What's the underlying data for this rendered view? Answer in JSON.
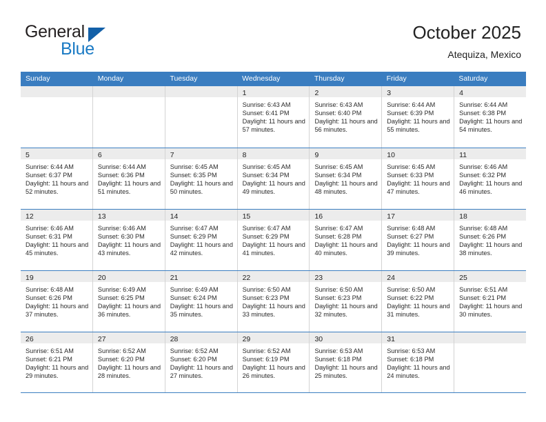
{
  "brand": {
    "name_part1": "General",
    "name_part2": "Blue",
    "triangle_color": "#1360a8",
    "blue_color": "#1a7ac4"
  },
  "header": {
    "title": "October 2025",
    "subtitle": "Atequiza, Mexico",
    "accent_color": "#3a7dc0",
    "band_color": "#ececec"
  },
  "calendar": {
    "day_headers": [
      "Sunday",
      "Monday",
      "Tuesday",
      "Wednesday",
      "Thursday",
      "Friday",
      "Saturday"
    ],
    "weeks": [
      [
        {
          "day": "",
          "empty": true
        },
        {
          "day": "",
          "empty": true
        },
        {
          "day": "",
          "empty": true
        },
        {
          "day": "1",
          "sunrise": "Sunrise: 6:43 AM",
          "sunset": "Sunset: 6:41 PM",
          "daylight": "Daylight: 11 hours and 57 minutes."
        },
        {
          "day": "2",
          "sunrise": "Sunrise: 6:43 AM",
          "sunset": "Sunset: 6:40 PM",
          "daylight": "Daylight: 11 hours and 56 minutes."
        },
        {
          "day": "3",
          "sunrise": "Sunrise: 6:44 AM",
          "sunset": "Sunset: 6:39 PM",
          "daylight": "Daylight: 11 hours and 55 minutes."
        },
        {
          "day": "4",
          "sunrise": "Sunrise: 6:44 AM",
          "sunset": "Sunset: 6:38 PM",
          "daylight": "Daylight: 11 hours and 54 minutes."
        }
      ],
      [
        {
          "day": "5",
          "sunrise": "Sunrise: 6:44 AM",
          "sunset": "Sunset: 6:37 PM",
          "daylight": "Daylight: 11 hours and 52 minutes."
        },
        {
          "day": "6",
          "sunrise": "Sunrise: 6:44 AM",
          "sunset": "Sunset: 6:36 PM",
          "daylight": "Daylight: 11 hours and 51 minutes."
        },
        {
          "day": "7",
          "sunrise": "Sunrise: 6:45 AM",
          "sunset": "Sunset: 6:35 PM",
          "daylight": "Daylight: 11 hours and 50 minutes."
        },
        {
          "day": "8",
          "sunrise": "Sunrise: 6:45 AM",
          "sunset": "Sunset: 6:34 PM",
          "daylight": "Daylight: 11 hours and 49 minutes."
        },
        {
          "day": "9",
          "sunrise": "Sunrise: 6:45 AM",
          "sunset": "Sunset: 6:34 PM",
          "daylight": "Daylight: 11 hours and 48 minutes."
        },
        {
          "day": "10",
          "sunrise": "Sunrise: 6:45 AM",
          "sunset": "Sunset: 6:33 PM",
          "daylight": "Daylight: 11 hours and 47 minutes."
        },
        {
          "day": "11",
          "sunrise": "Sunrise: 6:46 AM",
          "sunset": "Sunset: 6:32 PM",
          "daylight": "Daylight: 11 hours and 46 minutes."
        }
      ],
      [
        {
          "day": "12",
          "sunrise": "Sunrise: 6:46 AM",
          "sunset": "Sunset: 6:31 PM",
          "daylight": "Daylight: 11 hours and 45 minutes."
        },
        {
          "day": "13",
          "sunrise": "Sunrise: 6:46 AM",
          "sunset": "Sunset: 6:30 PM",
          "daylight": "Daylight: 11 hours and 43 minutes."
        },
        {
          "day": "14",
          "sunrise": "Sunrise: 6:47 AM",
          "sunset": "Sunset: 6:29 PM",
          "daylight": "Daylight: 11 hours and 42 minutes."
        },
        {
          "day": "15",
          "sunrise": "Sunrise: 6:47 AM",
          "sunset": "Sunset: 6:29 PM",
          "daylight": "Daylight: 11 hours and 41 minutes."
        },
        {
          "day": "16",
          "sunrise": "Sunrise: 6:47 AM",
          "sunset": "Sunset: 6:28 PM",
          "daylight": "Daylight: 11 hours and 40 minutes."
        },
        {
          "day": "17",
          "sunrise": "Sunrise: 6:48 AM",
          "sunset": "Sunset: 6:27 PM",
          "daylight": "Daylight: 11 hours and 39 minutes."
        },
        {
          "day": "18",
          "sunrise": "Sunrise: 6:48 AM",
          "sunset": "Sunset: 6:26 PM",
          "daylight": "Daylight: 11 hours and 38 minutes."
        }
      ],
      [
        {
          "day": "19",
          "sunrise": "Sunrise: 6:48 AM",
          "sunset": "Sunset: 6:26 PM",
          "daylight": "Daylight: 11 hours and 37 minutes."
        },
        {
          "day": "20",
          "sunrise": "Sunrise: 6:49 AM",
          "sunset": "Sunset: 6:25 PM",
          "daylight": "Daylight: 11 hours and 36 minutes."
        },
        {
          "day": "21",
          "sunrise": "Sunrise: 6:49 AM",
          "sunset": "Sunset: 6:24 PM",
          "daylight": "Daylight: 11 hours and 35 minutes."
        },
        {
          "day": "22",
          "sunrise": "Sunrise: 6:50 AM",
          "sunset": "Sunset: 6:23 PM",
          "daylight": "Daylight: 11 hours and 33 minutes."
        },
        {
          "day": "23",
          "sunrise": "Sunrise: 6:50 AM",
          "sunset": "Sunset: 6:23 PM",
          "daylight": "Daylight: 11 hours and 32 minutes."
        },
        {
          "day": "24",
          "sunrise": "Sunrise: 6:50 AM",
          "sunset": "Sunset: 6:22 PM",
          "daylight": "Daylight: 11 hours and 31 minutes."
        },
        {
          "day": "25",
          "sunrise": "Sunrise: 6:51 AM",
          "sunset": "Sunset: 6:21 PM",
          "daylight": "Daylight: 11 hours and 30 minutes."
        }
      ],
      [
        {
          "day": "26",
          "sunrise": "Sunrise: 6:51 AM",
          "sunset": "Sunset: 6:21 PM",
          "daylight": "Daylight: 11 hours and 29 minutes."
        },
        {
          "day": "27",
          "sunrise": "Sunrise: 6:52 AM",
          "sunset": "Sunset: 6:20 PM",
          "daylight": "Daylight: 11 hours and 28 minutes."
        },
        {
          "day": "28",
          "sunrise": "Sunrise: 6:52 AM",
          "sunset": "Sunset: 6:20 PM",
          "daylight": "Daylight: 11 hours and 27 minutes."
        },
        {
          "day": "29",
          "sunrise": "Sunrise: 6:52 AM",
          "sunset": "Sunset: 6:19 PM",
          "daylight": "Daylight: 11 hours and 26 minutes."
        },
        {
          "day": "30",
          "sunrise": "Sunrise: 6:53 AM",
          "sunset": "Sunset: 6:18 PM",
          "daylight": "Daylight: 11 hours and 25 minutes."
        },
        {
          "day": "31",
          "sunrise": "Sunrise: 6:53 AM",
          "sunset": "Sunset: 6:18 PM",
          "daylight": "Daylight: 11 hours and 24 minutes."
        },
        {
          "day": "",
          "empty": true
        }
      ]
    ]
  }
}
